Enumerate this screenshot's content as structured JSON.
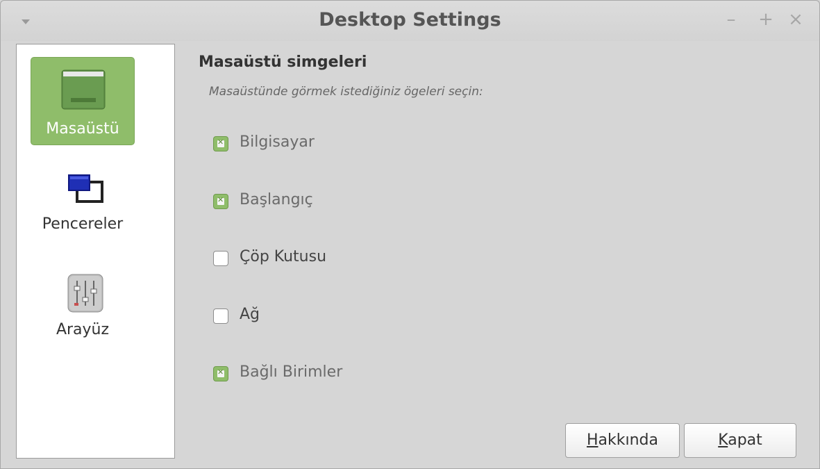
{
  "window": {
    "title": "Desktop Settings",
    "controls": {
      "minimize": "–",
      "maximize": "+",
      "close": "×"
    }
  },
  "sidebar": {
    "items": [
      {
        "label": "Masaüstü",
        "icon": "desktop-icon",
        "active": true
      },
      {
        "label": "Pencereler",
        "icon": "windows-icon",
        "active": false
      },
      {
        "label": "Arayüz",
        "icon": "sliders-icon",
        "active": false
      }
    ]
  },
  "main": {
    "heading": "Masaüstü simgeleri",
    "subheading": "Masaüstünde görmek istediğiniz ögeleri seçin:",
    "options": [
      {
        "label": "Bilgisayar",
        "checked": true
      },
      {
        "label": "Başlangıç",
        "checked": true
      },
      {
        "label": "Çöp Kutusu",
        "checked": false
      },
      {
        "label": "Ağ",
        "checked": false
      },
      {
        "label": "Bağlı Birimler",
        "checked": true
      }
    ]
  },
  "buttons": {
    "about": {
      "mnemonic": "H",
      "rest": "akkında"
    },
    "close": {
      "mnemonic": "K",
      "rest": "apat"
    }
  },
  "colors": {
    "accent": "#8fbd6a",
    "background": "#d6d6d6"
  }
}
